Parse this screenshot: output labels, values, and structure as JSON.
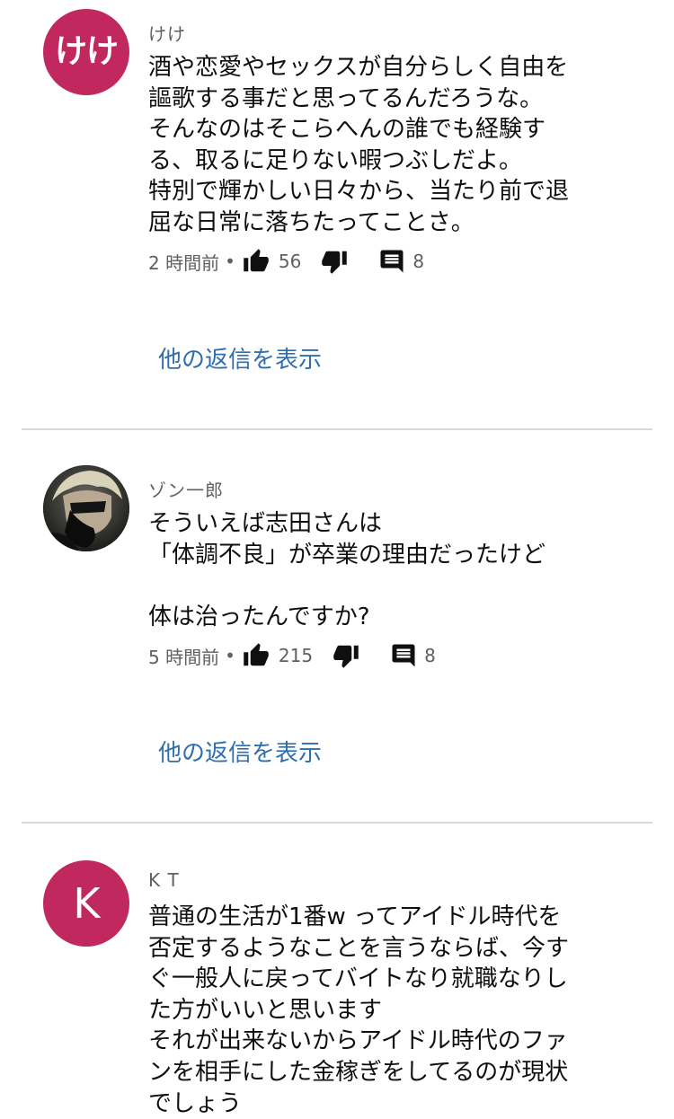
{
  "comments": [
    {
      "avatar_text": "けけ",
      "author": "けけ",
      "text": "酒や恋愛やセックスが自分らしく自由を\n謳歌する事だと思ってるんだろうな。\nそんなのはそこらへんの誰でも経験す\nる、取るに足りない暇つぶしだよ。\n特別で輝かしい日々から、当たり前で退\n屈な日常に落ちたってことさ。",
      "time": "2 時間前",
      "dot": "•",
      "likes": "56",
      "replies_count": "8",
      "show_replies": "他の返信を表示",
      "icons": {
        "like": "thumbs-up-icon",
        "dislike": "thumbs-down-icon",
        "reply": "comment-icon"
      }
    },
    {
      "avatar_text": "",
      "author": "ゾン一郎",
      "text": "そういえば志田さんは\n「体調不良」が卒業の理由だったけど\n\n体は治ったんですか?",
      "time": "5 時間前",
      "dot": "•",
      "likes": "215",
      "replies_count": "8",
      "show_replies": "他の返信を表示"
    },
    {
      "avatar_text": "K",
      "author": "K T",
      "text": "普通の生活が1番w ってアイドル時代を\n否定するようなことを言うならば、今す\nぐ一般人に戻ってバイトなり就職なりし\nた方がいいと思います\nそれが出来ないからアイドル時代のファ\nンを相手にした金稼ぎをしてるのが現状\nでしょう"
    }
  ],
  "colors": {
    "avatar": "#c0285e",
    "link": "#2f6fad",
    "meta": "#606060",
    "divider": "#d9d9d9"
  }
}
